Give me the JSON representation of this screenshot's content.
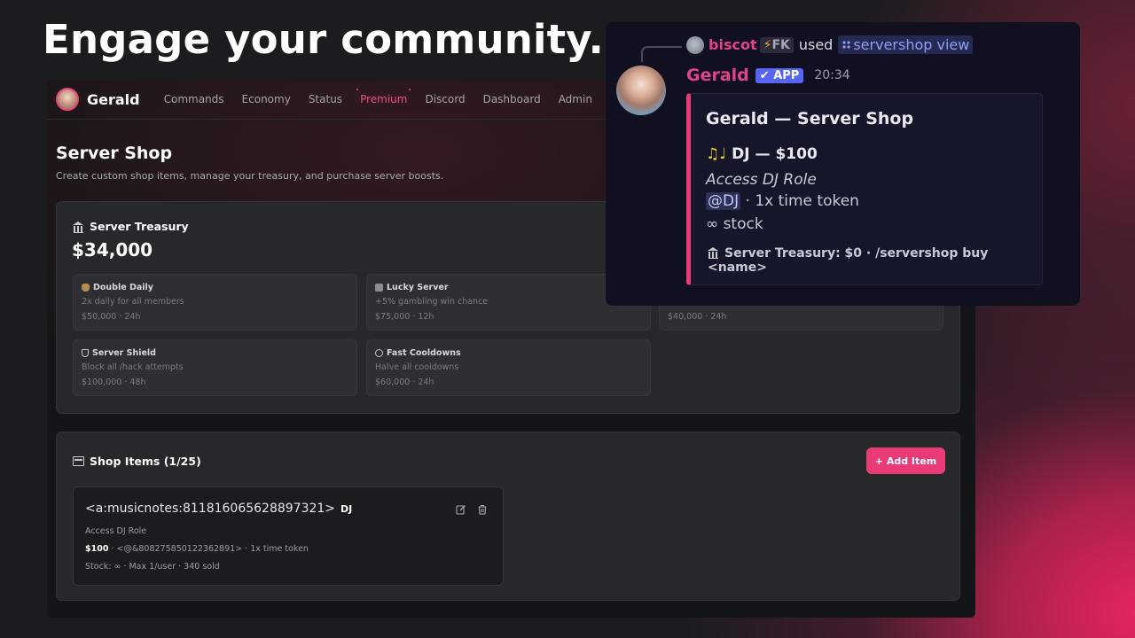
{
  "headline": "Engage your community.",
  "app": {
    "brand": "Gerald",
    "nav": [
      "Commands",
      "Economy",
      "Status",
      "Premium",
      "Discord",
      "Dashboard",
      "Admin"
    ],
    "page_title": "Server Shop",
    "page_subtitle": "Create custom shop items, manage your treasury, and purchase server boosts.",
    "treasury": {
      "title": "Server Treasury",
      "amount": "$34,000",
      "boosts": [
        {
          "name": "Double Daily",
          "desc": "2x daily for all members",
          "price": "$50,000 · 24h",
          "icon": "money-bag-icon"
        },
        {
          "name": "Lucky Server",
          "desc": "+5% gambling win chance",
          "price": "$75,000 · 12h",
          "icon": "dice-icon"
        },
        {
          "name": "",
          "desc": "",
          "price": "$40,000 · 24h",
          "icon": ""
        },
        {
          "name": "Server Shield",
          "desc": "Block all /hack attempts",
          "price": "$100,000 · 48h",
          "icon": "shield-icon"
        },
        {
          "name": "Fast Cooldowns",
          "desc": "Halve all cooldowns",
          "price": "$60,000 · 24h",
          "icon": "clock-icon"
        }
      ]
    },
    "shop": {
      "title": "Shop Items (1/25)",
      "add_label": "+ Add Item",
      "item": {
        "emoji": "<a:musicnotes:811816065628897321>",
        "name": "DJ",
        "desc": "Access DJ Role",
        "price": "$100",
        "meta": " · <@&808275850122362891> · 1x time token",
        "stock": "Stock: ∞ · Max 1/user · 340 sold"
      }
    }
  },
  "discord": {
    "reply_user": "biscot",
    "reply_tag": "FK",
    "reply_tag_icon": "⚡",
    "reply_used": "used",
    "reply_command": "servershop view",
    "author": "Gerald",
    "app_badge": "APP",
    "time": "20:34",
    "embed": {
      "title": "Gerald — Server Shop",
      "item_notes": "♫♩",
      "item": " DJ — $100",
      "desc": "Access DJ Role",
      "role_mention": "@DJ",
      "role_rest": " · 1x time token",
      "stock": "∞ stock",
      "footer": "Server Treasury: $0 · /servershop buy <name>"
    }
  },
  "colors": {
    "accent": "#e83b77",
    "discord_badge": "#5865f2",
    "background": "#1b1c20"
  }
}
